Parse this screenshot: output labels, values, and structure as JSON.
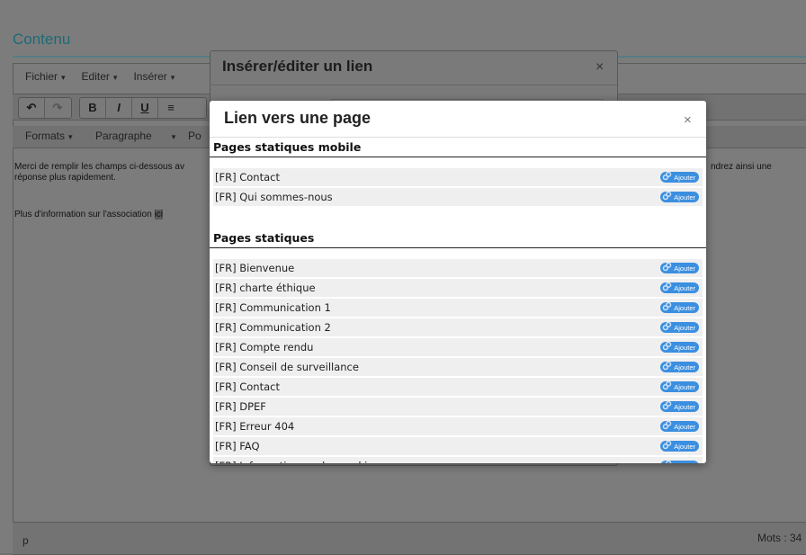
{
  "page": {
    "title": "Contenu"
  },
  "menubar": {
    "items": [
      {
        "label": "Fichier"
      },
      {
        "label": "Editer"
      },
      {
        "label": "Insérer"
      }
    ]
  },
  "toolbar": {
    "undo": "↶",
    "redo": "↷",
    "bold": "B",
    "italic": "I",
    "underline": "U",
    "align": "≡"
  },
  "format_bar": {
    "formats": "Formats",
    "paragraph": "Paragraphe",
    "partial": "Po"
  },
  "content": {
    "line1_a": "Merci de remplir les champs ci-dessous av",
    "line1_b": "ndrez ainsi une",
    "line2": "réponse plus rapidement.",
    "line3_a": "Plus d'information sur l'association ",
    "line3_link": "ici"
  },
  "status": {
    "path": "p",
    "words": "Mots : 34"
  },
  "dialog_link": {
    "title": "Insérer/éditer un lien",
    "close": "×"
  },
  "dialog_page": {
    "title": "Lien vers une page",
    "close": "×",
    "add_label": "Ajouter",
    "sections": [
      {
        "heading": "Pages statiques mobile",
        "pages": [
          "[FR] Contact",
          "[FR] Qui sommes-nous"
        ]
      },
      {
        "heading": "Pages statiques",
        "pages": [
          "[FR] Bienvenue",
          "[FR] charte éthique",
          "[FR] Communication 1",
          "[FR] Communication 2",
          "[FR] Compte rendu",
          "[FR] Conseil de surveillance",
          "[FR] Contact",
          "[FR] DPEF",
          "[FR] Erreur 404",
          "[FR] FAQ",
          "[FR] Information sur les cookies"
        ]
      }
    ]
  }
}
